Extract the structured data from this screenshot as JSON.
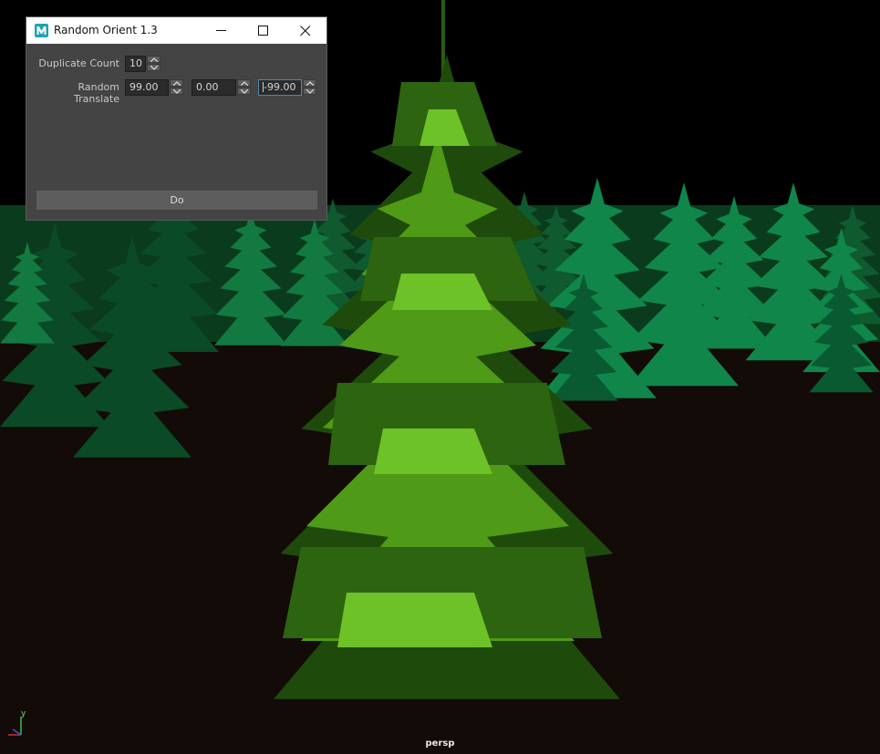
{
  "window": {
    "title": "Random Orient 1.3",
    "icon": "maya-app-icon"
  },
  "controls": {
    "duplicate_count_label": "Duplicate Count",
    "duplicate_count_value": "10",
    "random_translate_label": "Random Translate",
    "translate_x": "99.00",
    "translate_y": "0.00",
    "translate_z": "-99.00"
  },
  "do_button_label": "Do",
  "viewport": {
    "camera_label": "persp",
    "axis_label": "y"
  },
  "colors": {
    "ground": "#130b07",
    "sky": "#000000",
    "hero_tree": "#5aa81a",
    "background_trees": "#0c8a4a"
  }
}
